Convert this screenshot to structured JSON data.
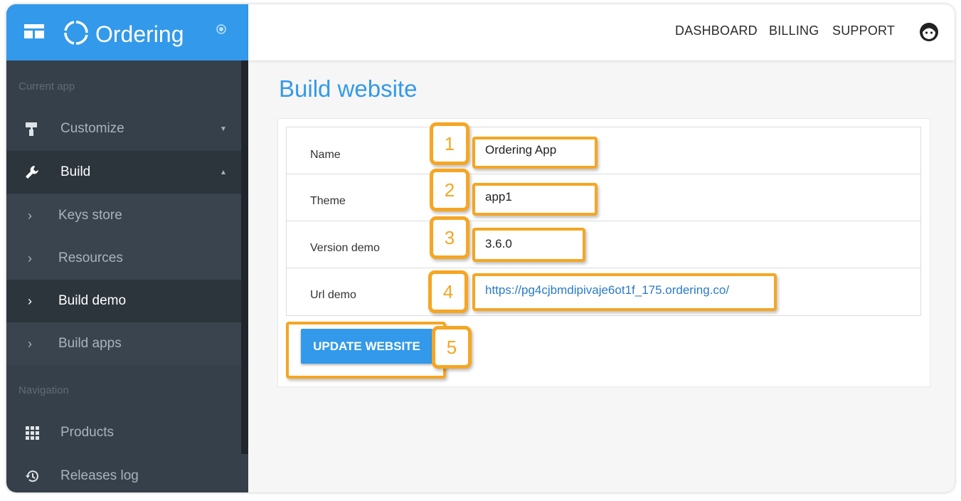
{
  "brand": {
    "name": "Ordering"
  },
  "sidebar": {
    "current_app_label": "Current app",
    "navigation_label": "Navigation",
    "items": [
      {
        "label": "Customize",
        "icon": "paint-roller-icon"
      },
      {
        "label": "Build",
        "icon": "wrench-icon"
      },
      {
        "label": "Keys store",
        "icon": "chevron-right-icon"
      },
      {
        "label": "Resources",
        "icon": "chevron-right-icon"
      },
      {
        "label": "Build demo",
        "icon": "chevron-right-icon",
        "active": true
      },
      {
        "label": "Build apps",
        "icon": "chevron-right-icon"
      },
      {
        "label": "Products",
        "icon": "grid-icon"
      },
      {
        "label": "Releases log",
        "icon": "history-icon"
      }
    ]
  },
  "topnav": {
    "dashboard": "DASHBOARD",
    "billing": "BILLING",
    "support": "SUPPORT"
  },
  "main": {
    "title": "Build website",
    "fields": {
      "name_label": "Name",
      "name_value": "Ordering App",
      "theme_label": "Theme",
      "theme_value": "app1",
      "version_label": "Version demo",
      "version_value": "3.6.0",
      "url_label": "Url demo",
      "url_value": "https://pg4cjbmdipivaje6ot1f_175.ordering.co/"
    },
    "update_button": "UPDATE WEBSITE"
  },
  "annotations": {
    "n1": "1",
    "n2": "2",
    "n3": "3",
    "n4": "4",
    "n5": "5"
  },
  "colors": {
    "accent": "#3399ea",
    "sidebar": "#36404a",
    "highlight": "#f5a623"
  }
}
